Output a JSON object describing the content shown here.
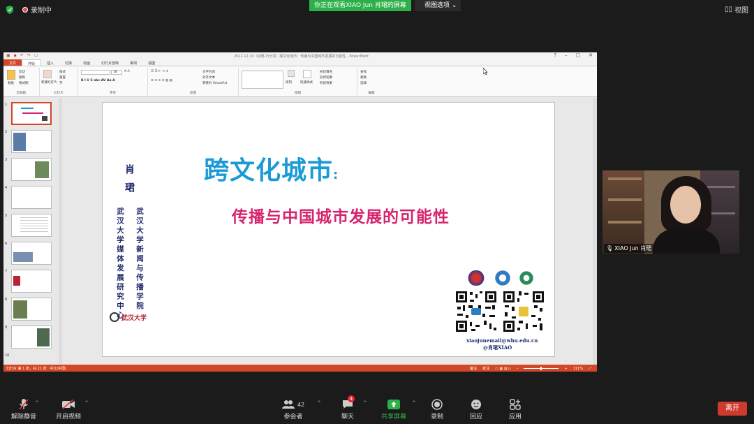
{
  "topbar": {
    "recording": "录制中",
    "banner": "你正在观看XIAO Jun 肖珺的屏幕",
    "view_options": "视图选项",
    "view_button": "视图"
  },
  "ppt": {
    "window_title": "2022.12.19（肖珺-巧分享）跨文化城市：传播与中国城市发展的可能性 - PowerPoint",
    "tabs": [
      "文件",
      "开始",
      "插入",
      "切换",
      "动画",
      "幻灯片放映",
      "审阅",
      "视图"
    ],
    "ribbon": {
      "paste": "粘贴",
      "cut": "剪切",
      "copy": "复制",
      "format_painter": "格式刷",
      "new_slide": "新建幻灯片",
      "layout": "版式",
      "reset": "重置",
      "section": "节",
      "font_size": "18",
      "text_direction": "文字方向",
      "align_text": "对齐文本",
      "smartart": "转换为 SmartArt",
      "arrange": "排列",
      "quick_styles": "快速样式",
      "shape_fill": "形状填充",
      "shape_outline": "形状轮廓",
      "shape_effects": "形状效果",
      "find": "查找",
      "replace": "替换",
      "select": "选择",
      "groups": [
        "剪贴板",
        "幻灯片",
        "字体",
        "段落",
        "绘图",
        "编辑"
      ]
    },
    "thumb_numbers": [
      "1",
      "2",
      "3",
      "4",
      "5",
      "6",
      "7",
      "8",
      "9",
      "10"
    ],
    "status_left": "幻灯片 第 1 张，共 21 张",
    "status_lang": "中文(中国)",
    "notes": "备注",
    "comments": "批注",
    "zoom": "111%"
  },
  "slide": {
    "title": "跨文化城市",
    "title_colon": ":",
    "subtitle": "传播与中国城市发展的可能性",
    "author": "肖珺",
    "org1": "武汉大学新闻与传播学院",
    "org2": "武汉大学媒体发展研究中心",
    "university_logo_text": "武汉大学",
    "email": "xiaojunemail@whu.edu.cn",
    "handle": "@肖珺XIAO"
  },
  "video": {
    "participant_name": "XIAO Jun 肖珺"
  },
  "toolbar": {
    "unmute": "解除静音",
    "start_video": "开启视频",
    "participants": "参会者",
    "participants_count": "42",
    "chat": "聊天",
    "chat_badge": "4",
    "share": "共享屏幕",
    "record": "录制",
    "reactions": "回应",
    "apps": "应用",
    "leave": "离开"
  },
  "colors": {
    "accent_blue": "#1a9ad6",
    "accent_magenta": "#d6246e",
    "ppt_orange": "#d24726",
    "zoom_green": "#2db04a",
    "leave_red": "#d0392e"
  }
}
